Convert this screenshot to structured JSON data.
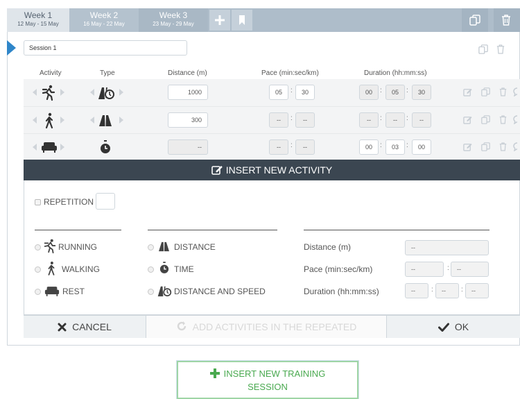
{
  "weeks": [
    {
      "label": "Week 1",
      "dates": "12 May - 15 May",
      "active": true
    },
    {
      "label": "Week 2",
      "dates": "16 May - 22 May",
      "active": false
    },
    {
      "label": "Week 3",
      "dates": "23 May - 29 May",
      "active": false
    }
  ],
  "icons": {
    "add_week": "plus-icon",
    "bookmark": "bookmark-icon",
    "copy": "copy-icon",
    "delete": "trash-icon",
    "edit": "edit-icon",
    "comment": "comment-icon",
    "running": "running-icon",
    "walking": "walking-icon",
    "rest": "sofa-icon",
    "distance": "road-icon",
    "time": "stopwatch-icon",
    "distance_speed": "road-stopwatch-icon"
  },
  "session": {
    "name": "Session 1"
  },
  "table": {
    "headers": {
      "activity": "Activity",
      "type": "Type",
      "distance": "Distance (m)",
      "pace": "Pace (min:sec/km)",
      "duration": "Duration (hh:mm:ss)"
    },
    "rows": [
      {
        "activity": "running",
        "type": "distance_speed",
        "distance": "1000",
        "pace_min": "05",
        "pace_sec": "30",
        "dur_h": "00",
        "dur_m": "05",
        "dur_s": "30"
      },
      {
        "activity": "walking",
        "type": "distance",
        "distance": "300",
        "pace_min": "--",
        "pace_sec": "--",
        "dur_h": "--",
        "dur_m": "--",
        "dur_s": "--"
      },
      {
        "activity": "rest",
        "type": "time",
        "distance": "--",
        "pace_min": "--",
        "pace_sec": "--",
        "dur_h": "00",
        "dur_m": "03",
        "dur_s": "00"
      }
    ],
    "separator": ":"
  },
  "insert_activity": {
    "title": "INSERT NEW ACTIVITY",
    "repetition_label": "REPETITION",
    "activities": [
      "RUNNING",
      "WALKING",
      "REST"
    ],
    "types": [
      "DISTANCE",
      "TIME",
      "DISTANCE AND SPEED"
    ],
    "fields": {
      "distance_label": "Distance (m)",
      "pace_label": "Pace (min:sec/km)",
      "duration_label": "Duration (hh:mm:ss)",
      "placeholder": "--"
    },
    "buttons": {
      "cancel": "CANCEL",
      "add_repeated": "ADD ACTIVITIES IN THE REPEATED",
      "ok": "OK"
    }
  },
  "new_session_button": {
    "line1": "INSERT NEW TRAINING",
    "line2": "SESSION"
  },
  "colors": {
    "week_bar": "#aebdca",
    "active_tab": "#dfe5ea",
    "session_marker": "#2f86c9",
    "dialog_header": "#3b4651",
    "new_session_green": "#49a94f"
  }
}
